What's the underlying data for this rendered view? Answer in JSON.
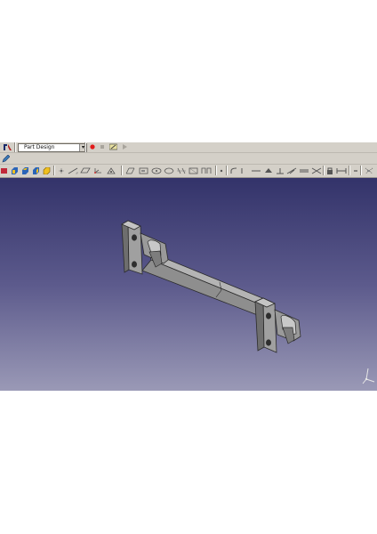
{
  "workbench": {
    "selected": "Part Design"
  },
  "toolbar_top": {
    "workbench_icon": "freecad-logo-icon",
    "macro_record": "record-icon",
    "macro_stop": "stop-icon",
    "macro_edit": "macro-edit-icon",
    "macro_run": "play-icon"
  },
  "toolbar_second": {
    "icon": "pencil-icon"
  },
  "colors": {
    "background_top": "#33336a",
    "background_bottom": "#9a99b6",
    "part": "#8e8e8e",
    "toolbar": "#d4d0c8"
  }
}
